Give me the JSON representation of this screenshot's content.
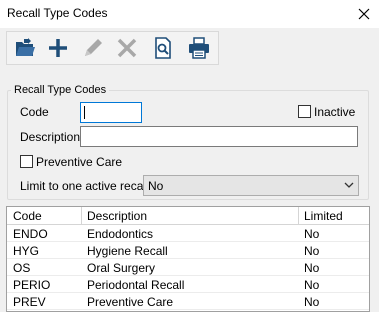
{
  "window": {
    "title": "Recall Type Codes",
    "close_glyph": "✕"
  },
  "toolbar": {
    "buttons": [
      {
        "name": "open-icon",
        "enabled": true
      },
      {
        "name": "add-icon",
        "enabled": true
      },
      {
        "name": "edit-icon",
        "enabled": false
      },
      {
        "name": "delete-icon",
        "enabled": false
      },
      {
        "name": "preview-icon",
        "enabled": true
      },
      {
        "name": "print-icon",
        "enabled": true
      }
    ]
  },
  "form": {
    "group_label": "Recall Type Codes",
    "code_label": "Code",
    "code_value": "",
    "inactive_label": "Inactive",
    "inactive_checked": false,
    "description_label": "Description",
    "description_value": "",
    "preventive_label": "Preventive Care",
    "preventive_checked": false,
    "limit_label": "Limit to one active recall",
    "limit_value": "No"
  },
  "grid": {
    "headers": [
      "Code",
      "Description",
      "Limited"
    ],
    "rows": [
      [
        "ENDO",
        "Endodontics",
        "No"
      ],
      [
        "HYG",
        "Hygiene Recall",
        "No"
      ],
      [
        "OS",
        "Oral Surgery",
        "No"
      ],
      [
        "PERIO",
        "Periodontal Recall",
        "No"
      ],
      [
        "PREV",
        "Preventive Care",
        "No"
      ]
    ]
  },
  "colors": {
    "accent": "#0078d7",
    "icon": "#1f4e79",
    "disabled": "#a8a8a8"
  }
}
